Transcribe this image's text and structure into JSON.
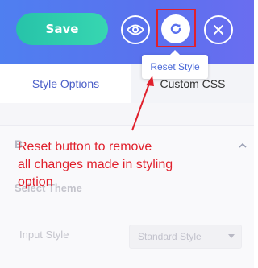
{
  "toolbar": {
    "save_label": "Save",
    "view_icon": "eye-icon",
    "reset_icon": "reset-icon",
    "close_icon": "close-icon",
    "tooltip": "Reset Style",
    "colors": {
      "bar": "#5a71ee",
      "save": "#2fcdae",
      "highlight": "#e0202c"
    }
  },
  "tabs": [
    {
      "label": "Style Options"
    },
    {
      "label": "Custom CSS"
    }
  ],
  "panel": {
    "section_title": "B",
    "select_theme_label": "Select Theme",
    "input_style_label": "Input Style",
    "input_style_value": "Standard Style"
  },
  "annotation": {
    "line1": "Reset button to remove",
    "line2": "all changes made in styling",
    "line3": "option"
  }
}
